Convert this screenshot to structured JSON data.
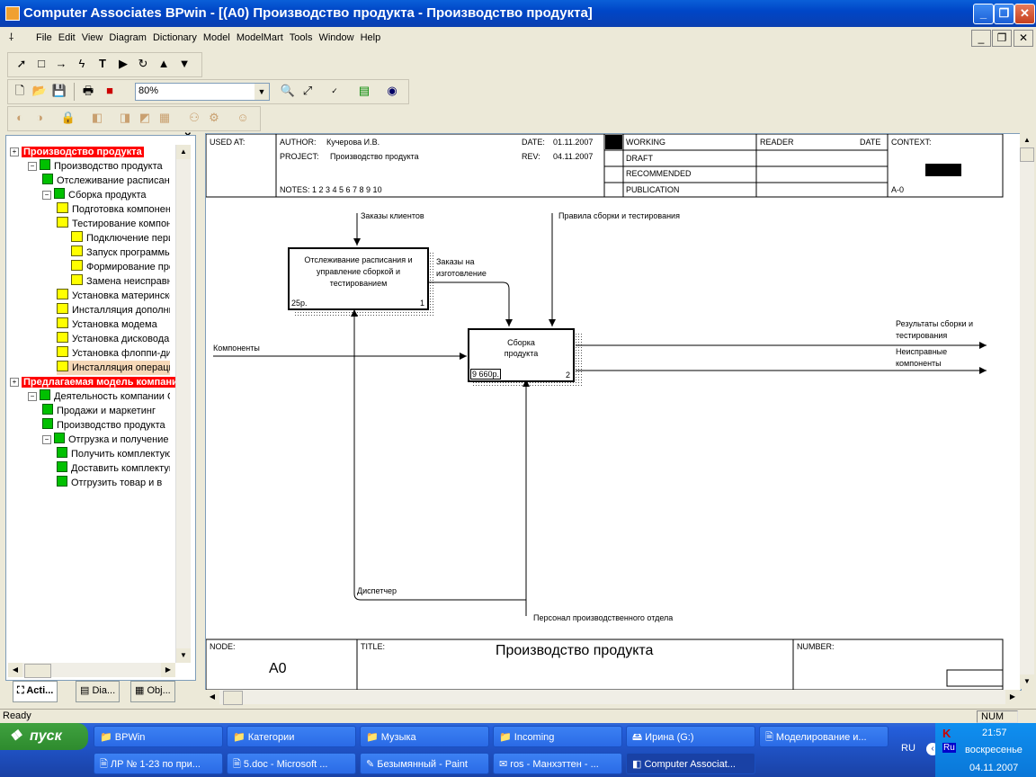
{
  "window": {
    "title": "Computer Associates BPwin - [(A0) Производство продукта - Производство продукта]",
    "minimize": "0",
    "maximize": "1",
    "close": "r"
  },
  "menu": [
    "File",
    "Edit",
    "View",
    "Diagram",
    "Dictionary",
    "Model",
    "ModelMart",
    "Tools",
    "Window",
    "Help"
  ],
  "toolbar": {
    "zoom": "80%"
  },
  "tree": {
    "model1": "Производство продукта",
    "model1_items": [
      {
        "level": 1,
        "icon": "green",
        "label": "Производство продукта"
      },
      {
        "level": 2,
        "icon": "green",
        "label": "Отслеживание расписания и управление сборкой и тестированием"
      },
      {
        "level": 2,
        "icon": "green",
        "label": "Сборка продукта"
      },
      {
        "level": 3,
        "icon": "yellow",
        "label": "Подготовка компонентов"
      },
      {
        "level": 3,
        "icon": "yellow",
        "label": "Тестирование компонентов"
      },
      {
        "level": 4,
        "icon": "yellow",
        "label": "Подключение периферии"
      },
      {
        "level": 4,
        "icon": "yellow",
        "label": "Запуск программы тестирования"
      },
      {
        "level": 4,
        "icon": "yellow",
        "label": "Формирование протокола"
      },
      {
        "level": 4,
        "icon": "yellow",
        "label": "Замена неисправных компонентов"
      },
      {
        "level": 3,
        "icon": "yellow",
        "label": "Установка материнской платы"
      },
      {
        "level": 3,
        "icon": "yellow",
        "label": "Инсталляция дополнительных плат"
      },
      {
        "level": 3,
        "icon": "yellow",
        "label": "Установка модема"
      },
      {
        "level": 3,
        "icon": "yellow",
        "label": "Установка дисковода"
      },
      {
        "level": 3,
        "icon": "yellow",
        "label": "Установка флоппи-дисковода"
      },
      {
        "level": 3,
        "icon": "yellow",
        "label": "Инсталляция операционной системы"
      }
    ],
    "model2": "Предлагаемая модель компании",
    "model2_items": [
      {
        "level": 1,
        "icon": "green",
        "label": "Деятельность компании Comp"
      },
      {
        "level": 2,
        "icon": "green",
        "label": "Продажи и маркетинг"
      },
      {
        "level": 2,
        "icon": "green",
        "label": "Производство продукта"
      },
      {
        "level": 2,
        "icon": "green",
        "label": "Отгрузка и получение"
      },
      {
        "level": 3,
        "icon": "green",
        "label": "Получить комплектующие"
      },
      {
        "level": 3,
        "icon": "green",
        "label": "Доставить комплектующие"
      },
      {
        "level": 3,
        "icon": "green",
        "label": "Отгрузить товар и в"
      }
    ],
    "tabs": [
      "Acti...",
      "Dia...",
      "Obj..."
    ]
  },
  "frame": {
    "used_at": "USED AT:",
    "author_label": "AUTHOR:",
    "author": "Кучерова И.В.",
    "project_label": "PROJECT:",
    "project": "Производство продукта",
    "date_label": "DATE:",
    "date": "01.11.2007",
    "rev_label": "REV:",
    "rev": "04.11.2007",
    "notes": "NOTES:  1  2  3  4  5  6  7  8  9  10",
    "status": [
      "WORKING",
      "DRAFT",
      "RECOMMENDED",
      "PUBLICATION"
    ],
    "reader": "READER",
    "reader_date": "DATE",
    "context": "CONTEXT:",
    "context_node": "A-0",
    "node_label": "NODE:",
    "node": "A0",
    "title_label": "TITLE:",
    "title": "Производство продукта",
    "number_label": "NUMBER:"
  },
  "diagram": {
    "box1": {
      "text": "Отслеживание расписания и управление сборкой и тестированием",
      "cost": "25р.",
      "num": "1"
    },
    "box2": {
      "text": "Сборка продукта",
      "cost": "9 660р.",
      "num": "2"
    },
    "arrows": {
      "orders": "Заказы клиентов",
      "rules": "Правила сборки и тестирования",
      "mfg_orders": "Заказы на изготовление",
      "components": "Компоненты",
      "results": "Результаты сборки и тестирования",
      "faulty": "Неисправные компоненты",
      "dispatcher": "Диспетчер",
      "personnel": "Персонал производственного отдела"
    }
  },
  "status": {
    "left": "Ready",
    "num": "NUM"
  },
  "taskbar": {
    "start": "пуск",
    "row1": [
      "BPWin",
      "Категории",
      "Музыка",
      "Incoming",
      "Ирина (G:)",
      "Моделирование и..."
    ],
    "row2": [
      "ЛР № 1-23 по при...",
      "5.doc - Microsoft ...",
      "Безымянный - Paint",
      "ros - Манхэттен - ...",
      "Computer Associat..."
    ],
    "lang": "RU",
    "time": "21:57",
    "day": "воскресенье",
    "date": "04.11.2007"
  }
}
